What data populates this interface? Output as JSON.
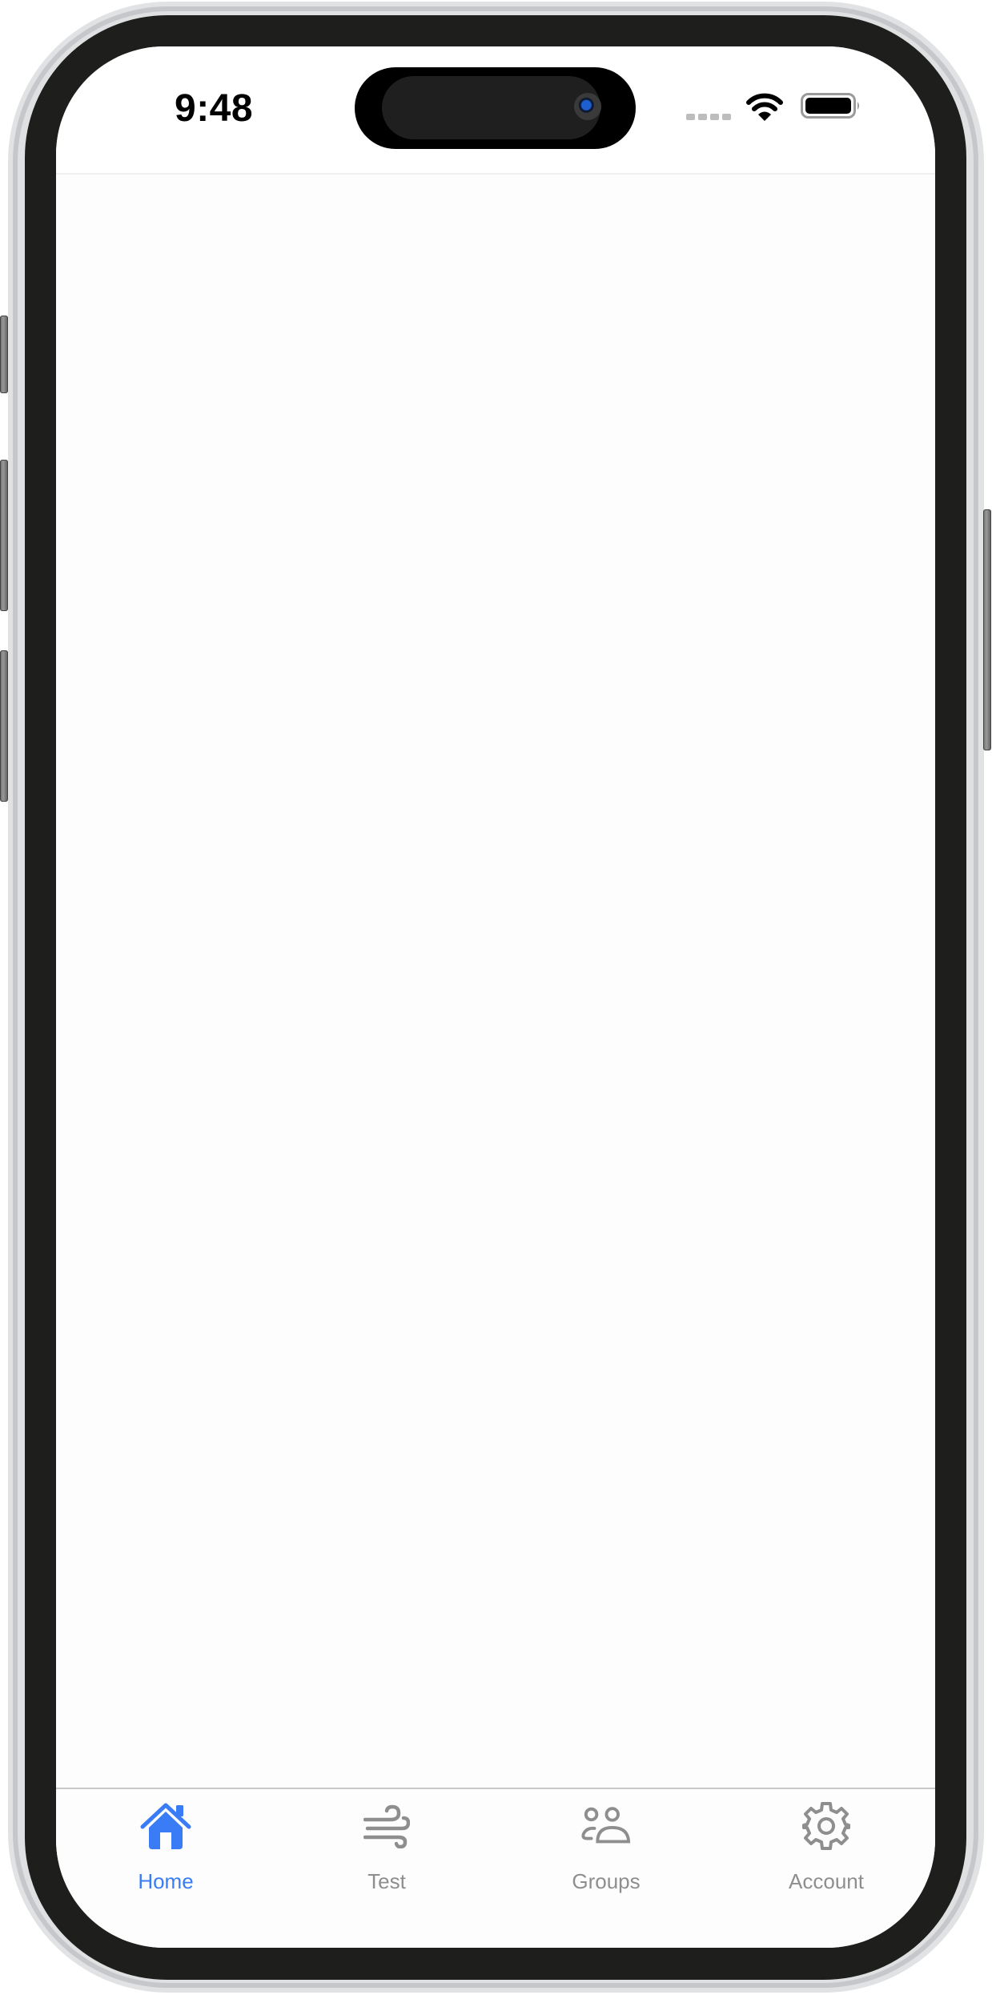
{
  "device": {
    "frame_color": "#1e1e1c",
    "accent_color": "#3a7cf5",
    "inactive_color": "#8e8e8e"
  },
  "status_bar": {
    "time": "9:48",
    "signal_icon": "cellular-signal-icon",
    "wifi_icon": "wifi-icon",
    "battery_icon": "battery-icon"
  },
  "content": {
    "empty": true
  },
  "tab_bar": {
    "active_index": 0,
    "tabs": [
      {
        "label": "Home",
        "icon": "house-icon",
        "active": true
      },
      {
        "label": "Test",
        "icon": "wind-icon",
        "active": false
      },
      {
        "label": "Groups",
        "icon": "people-icon",
        "active": false
      },
      {
        "label": "Account",
        "icon": "gear-icon",
        "active": false
      }
    ]
  }
}
